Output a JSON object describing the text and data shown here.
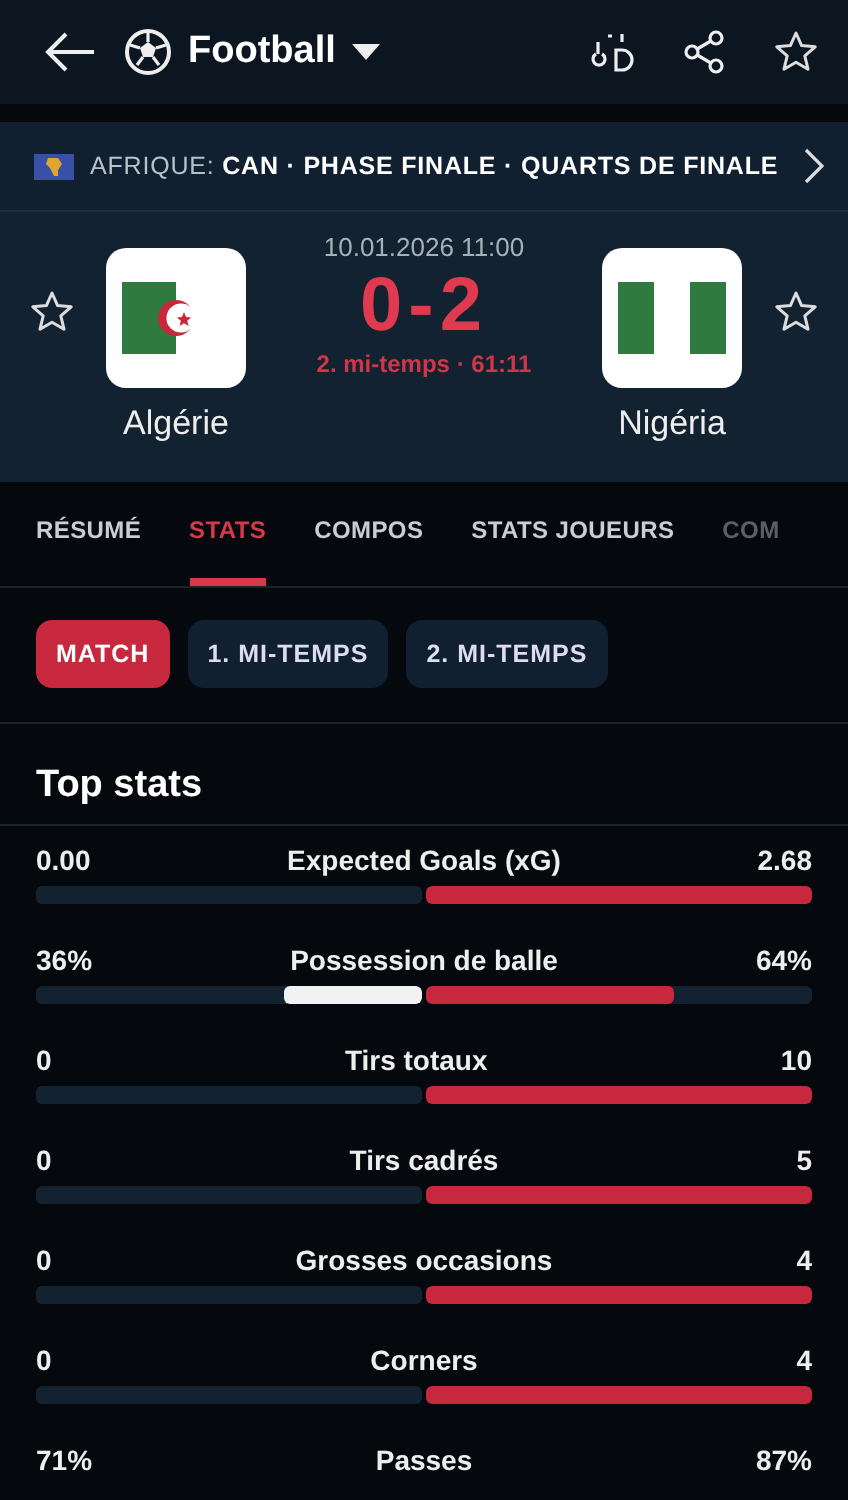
{
  "header": {
    "sport": "Football"
  },
  "competition": {
    "text": "AFRIQUE: **CAN · PHASE FINALE · QUARTS DE FINALE**"
  },
  "match": {
    "datetime": "10.01.2026 11:00",
    "score": "0-2",
    "status": "2. mi-temps · 61:11",
    "home": {
      "name": "Algérie",
      "favorite": false
    },
    "away": {
      "name": "Nigéria",
      "favorite": false
    }
  },
  "tabs": [
    {
      "label": "RÉSUMÉ",
      "selected": false
    },
    {
      "label": "STATS",
      "selected": true
    },
    {
      "label": "COMPOS",
      "selected": false
    },
    {
      "label": "STATS JOUEURS",
      "selected": false
    },
    {
      "label": "COM",
      "selected": false
    }
  ],
  "periods": [
    {
      "label": "MATCH",
      "selected": true
    },
    {
      "label": "1. MI-TEMPS",
      "selected": false
    },
    {
      "label": "2. MI-TEMPS",
      "selected": false
    }
  ],
  "section_title": "Top stats",
  "stats": [
    {
      "label": "Expected Goals (xG)",
      "home": "0.00",
      "away": "2.68",
      "home_bar": {
        "level": 0
      },
      "away_bar": {
        "level": 1
      }
    },
    {
      "label": "Possession de balle",
      "home": "36%",
      "away": "64%",
      "home_bar": {
        "level": 0.36
      },
      "away_bar": {
        "level": 0.64
      }
    },
    {
      "label": "Tirs totaux",
      "home": "0",
      "away": "10",
      "home_bar": {
        "level": 0
      },
      "away_bar": {
        "level": 1
      }
    },
    {
      "label": "Tirs cadrés",
      "home": "0",
      "away": "5",
      "home_bar": {
        "level": 0
      },
      "away_bar": {
        "level": 1
      }
    },
    {
      "label": "Grosses occasions",
      "home": "0",
      "away": "4",
      "home_bar": {
        "level": 0
      },
      "away_bar": {
        "level": 1
      }
    },
    {
      "label": "Corners",
      "home": "0",
      "away": "4",
      "home_bar": {
        "level": 0
      },
      "away_bar": {
        "level": 1
      }
    },
    {
      "label": "Passes",
      "home": "71%",
      "away": "87%"
    }
  ]
}
